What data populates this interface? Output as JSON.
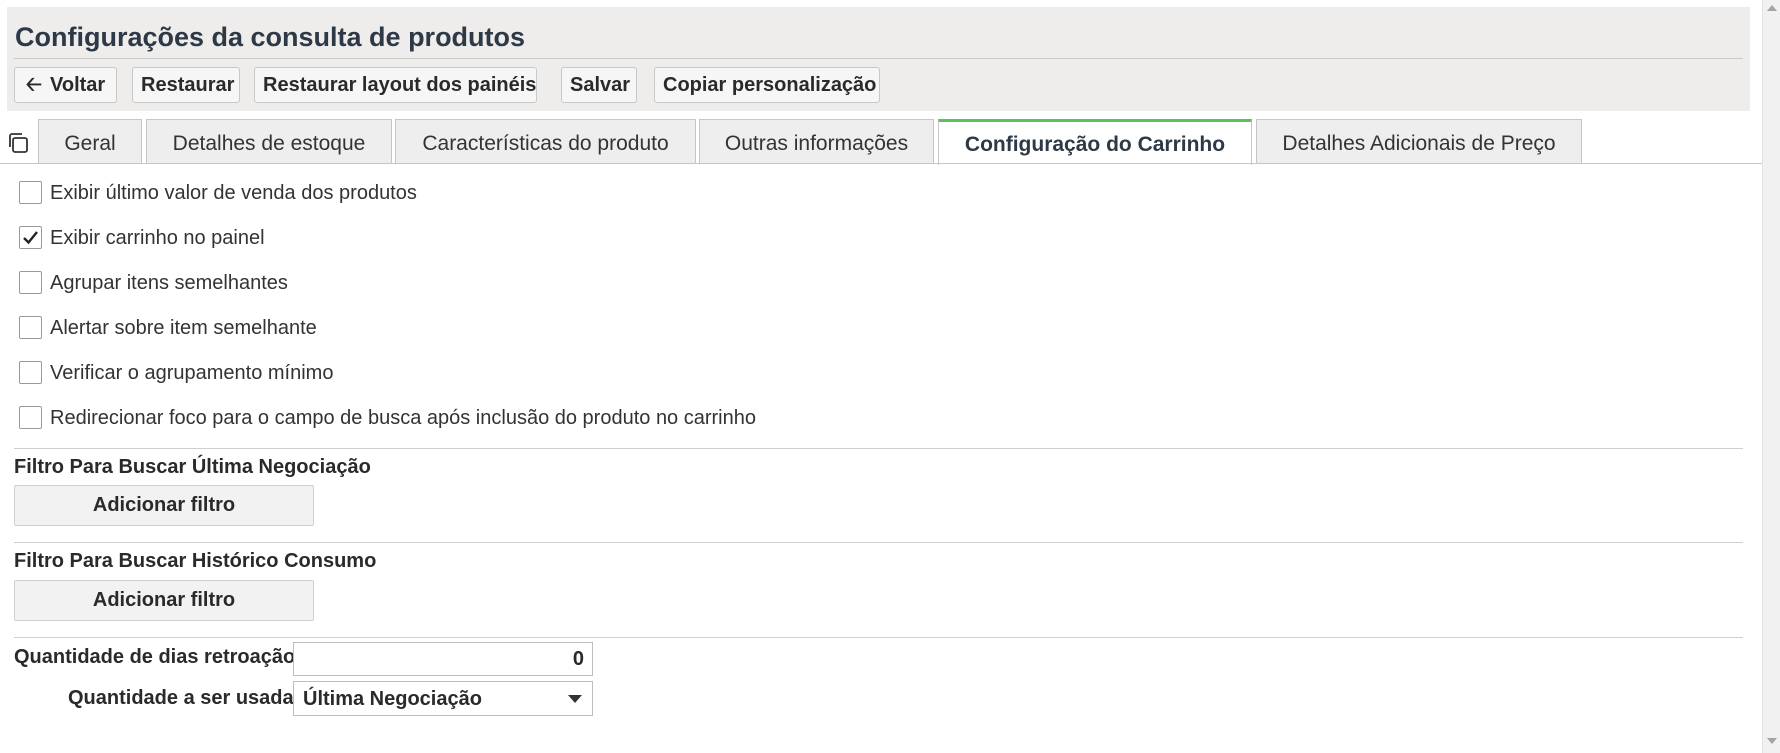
{
  "page": {
    "title": "Configurações da consulta de produtos"
  },
  "toolbar": {
    "back_label": "Voltar",
    "restore_label": "Restaurar",
    "restore_layout_label": "Restaurar layout dos painéis",
    "save_label": "Salvar",
    "copy_label": "Copiar personalização"
  },
  "tabs": [
    {
      "label": "Geral",
      "active": false
    },
    {
      "label": "Detalhes de estoque",
      "active": false
    },
    {
      "label": "Características do produto",
      "active": false
    },
    {
      "label": "Outras informações",
      "active": false
    },
    {
      "label": "Configuração do Carrinho",
      "active": true
    },
    {
      "label": "Detalhes Adicionais de Preço",
      "active": false
    }
  ],
  "checkboxes": [
    {
      "label": "Exibir último valor de venda dos produtos",
      "checked": false
    },
    {
      "label": "Exibir carrinho no painel",
      "checked": true
    },
    {
      "label": "Agrupar itens semelhantes",
      "checked": false
    },
    {
      "label": "Alertar sobre item semelhante",
      "checked": false
    },
    {
      "label": "Verificar o agrupamento mínimo",
      "checked": false
    },
    {
      "label": "Redirecionar foco para o campo de busca após inclusão do produto no carrinho",
      "checked": false
    }
  ],
  "filter_last_negotiation": {
    "label": "Filtro Para Buscar Última Negociação",
    "button_label": "Adicionar filtro"
  },
  "filter_consumption_history": {
    "label": "Filtro Para Buscar Histórico Consumo",
    "button_label": "Adicionar filtro"
  },
  "days_back": {
    "label": "Quantidade de dias retroação",
    "value": "0"
  },
  "quantity_used": {
    "label": "Quantidade a ser usada",
    "selected": "Última Negociação"
  },
  "icons": {
    "back": "arrow-left-icon",
    "tabs_menu": "copy-windows-icon",
    "check": "checkmark-icon",
    "dropdown": "caret-down-icon"
  },
  "colors": {
    "header_bg": "#eeedeb",
    "active_tab_accent": "#55c45a",
    "title_color": "#2d3947"
  }
}
